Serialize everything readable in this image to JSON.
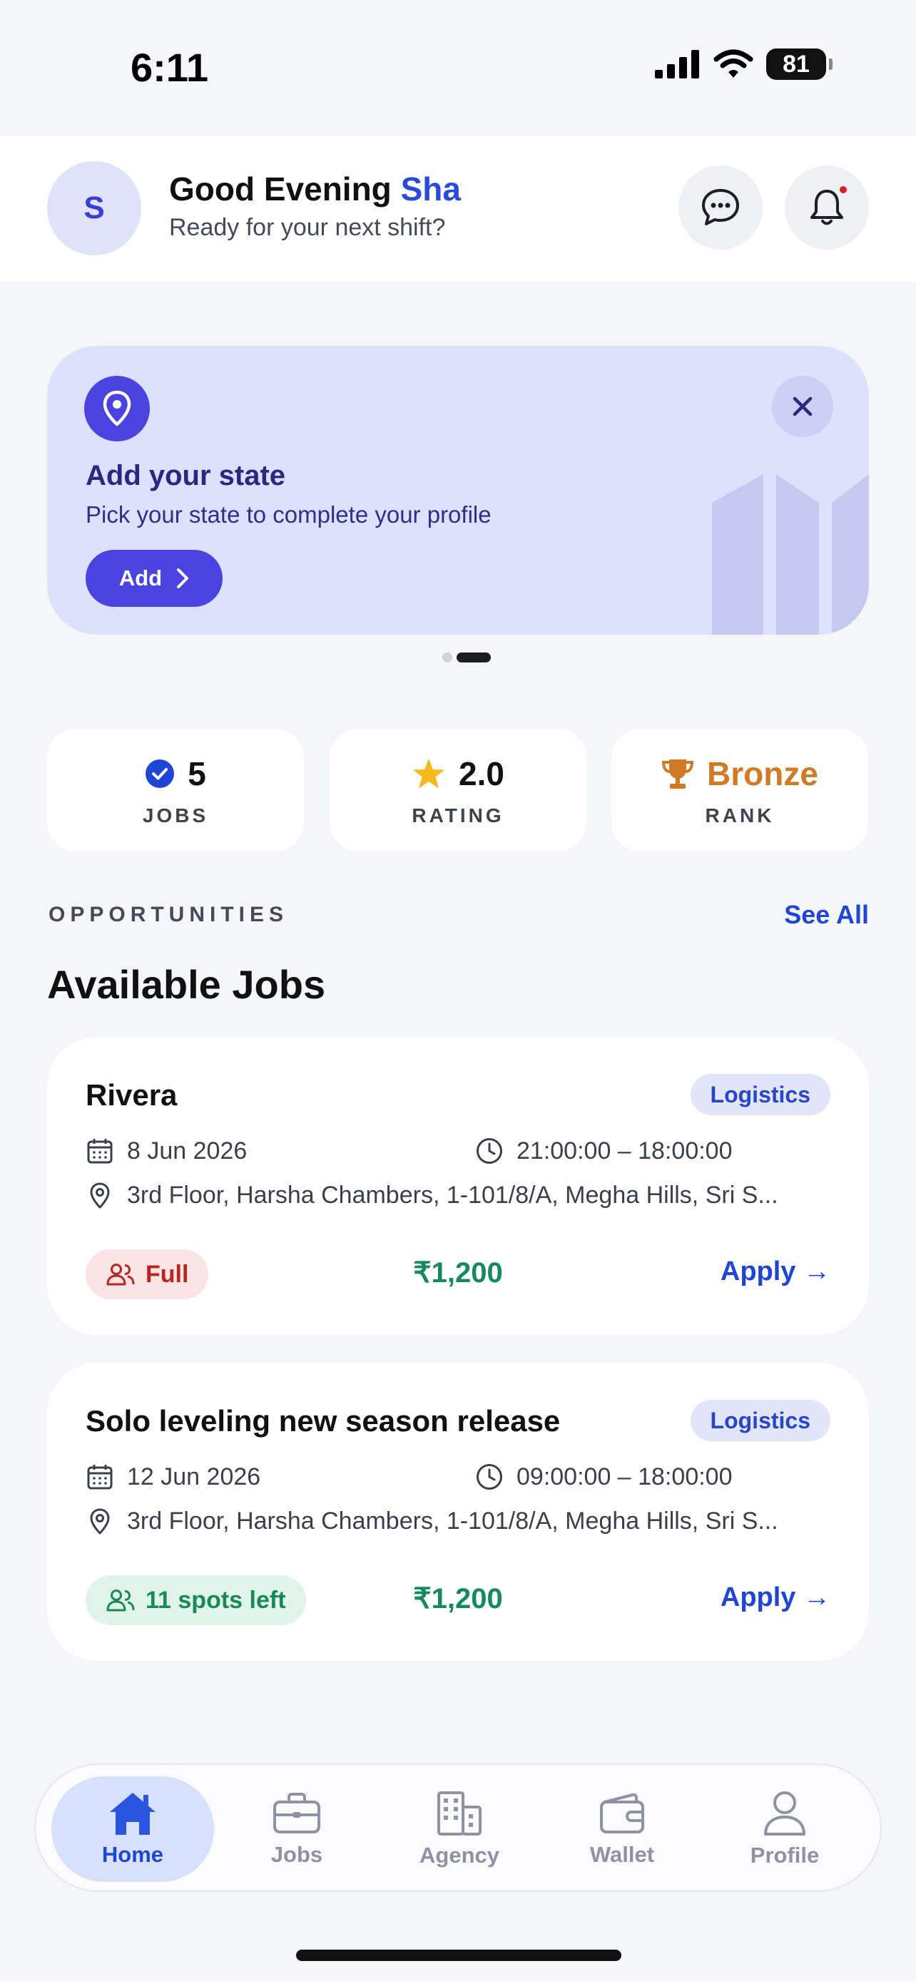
{
  "status": {
    "time": "6:11",
    "battery": "81"
  },
  "header": {
    "avatar_initial": "S",
    "greeting": "Good Evening",
    "name": "Sha",
    "subtitle": "Ready for your next shift?"
  },
  "banner": {
    "title": "Add your state",
    "subtitle": "Pick your state to complete your profile",
    "button": "Add"
  },
  "stats": [
    {
      "value": "5",
      "label": "JOBS",
      "icon": "check-circle-icon"
    },
    {
      "value": "2.0",
      "label": "RATING",
      "icon": "star-icon"
    },
    {
      "value": "Bronze",
      "label": "RANK",
      "icon": "trophy-icon"
    }
  ],
  "section": {
    "kicker": "OPPORTUNITIES",
    "title": "Available Jobs",
    "see_all": "See All"
  },
  "jobs": [
    {
      "title": "Rivera",
      "tag": "Logistics",
      "date": "8 Jun 2026",
      "time": "21:00:00 – 18:00:00",
      "address": "3rd Floor, Harsha Chambers, 1-101/8/A, Megha Hills, Sri S...",
      "availability": "Full",
      "price": "₹1,200",
      "apply": "Apply →"
    },
    {
      "title": "Solo leveling new season release",
      "tag": "Logistics",
      "date": "12 Jun 2026",
      "time": "09:00:00 – 18:00:00",
      "address": "3rd Floor, Harsha Chambers, 1-101/8/A, Megha Hills, Sri S...",
      "availability": "11 spots left",
      "price": "₹1,200",
      "apply": "Apply →"
    }
  ],
  "nav": [
    {
      "label": "Home",
      "icon": "home-icon",
      "active": true
    },
    {
      "label": "Jobs",
      "icon": "briefcase-icon",
      "active": false
    },
    {
      "label": "Agency",
      "icon": "building-icon",
      "active": false
    },
    {
      "label": "Wallet",
      "icon": "wallet-icon",
      "active": false
    },
    {
      "label": "Profile",
      "icon": "user-icon",
      "active": false
    }
  ],
  "colors": {
    "accent": "#4a43e0",
    "link": "#1f45d6",
    "price": "#168a5a",
    "bronze": "#d07a25"
  }
}
